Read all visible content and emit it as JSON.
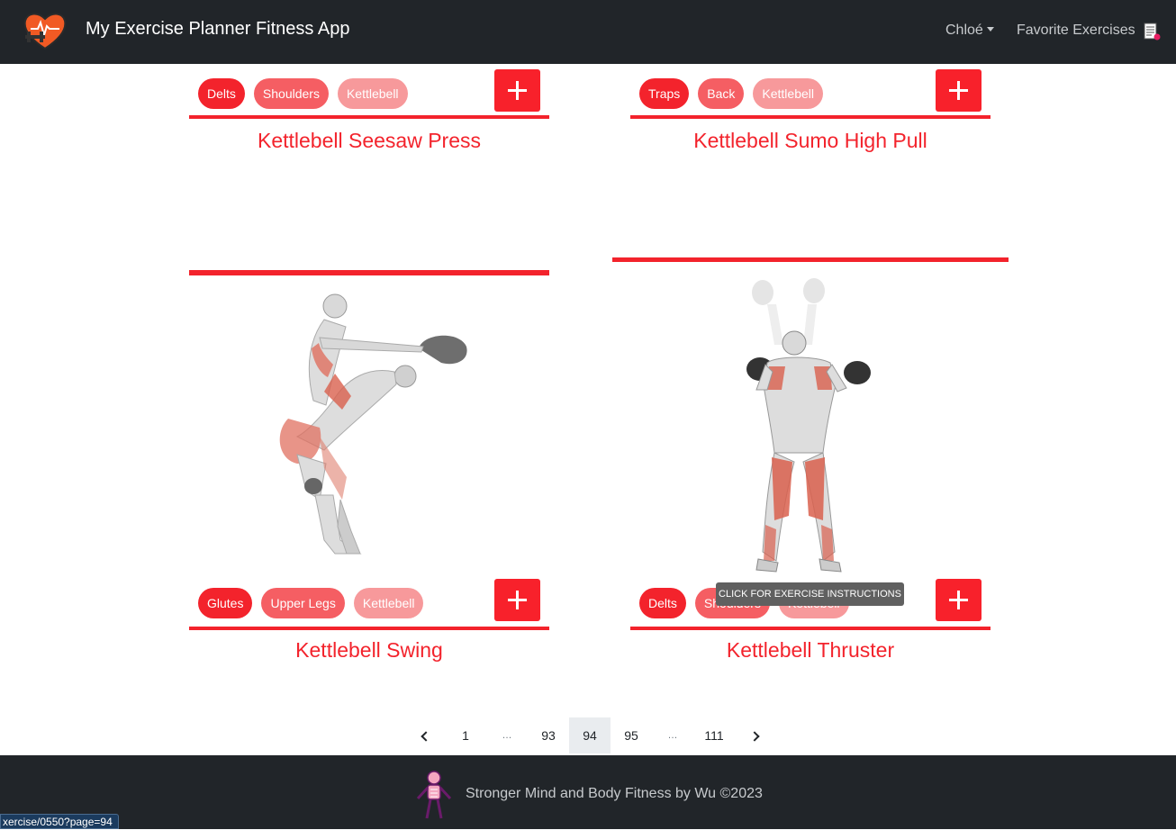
{
  "header": {
    "title": "My Exercise Planner Fitness App",
    "user_label": "Chloé",
    "favorites_label": "Favorite Exercises",
    "logo_icon": "heart-dumbbell-icon",
    "favorites_icon": "clipboard-list-icon"
  },
  "cards": [
    {
      "title": "Kettlebell Seesaw Press",
      "tags": [
        "Delts",
        "Shoulders",
        "Kettlebell"
      ]
    },
    {
      "title": "Kettlebell Sumo High Pull",
      "tags": [
        "Traps",
        "Back",
        "Kettlebell"
      ]
    },
    {
      "title": "Kettlebell Swing",
      "tags": [
        "Glutes",
        "Upper Legs",
        "Kettlebell"
      ]
    },
    {
      "title": "Kettlebell Thruster",
      "tags": [
        "Delts",
        "Shoulders",
        "Kettlebell"
      ]
    }
  ],
  "tooltip": "CLICK FOR EXERCISE INSTRUCTIONS",
  "pagination": {
    "pages": [
      "1",
      "…",
      "93",
      "94",
      "95",
      "…",
      "111"
    ],
    "current": "94"
  },
  "footer": {
    "text": "Stronger Mind and Body Fitness by Wu ©2023",
    "logo_icon": "skeleton-figure-icon"
  },
  "status_url": "xercise/0550?page=94",
  "colors": {
    "navbar": "#212529",
    "accent_red": "#f3232c",
    "tag_mid": "#f55e63",
    "tag_light": "#f7999b"
  }
}
